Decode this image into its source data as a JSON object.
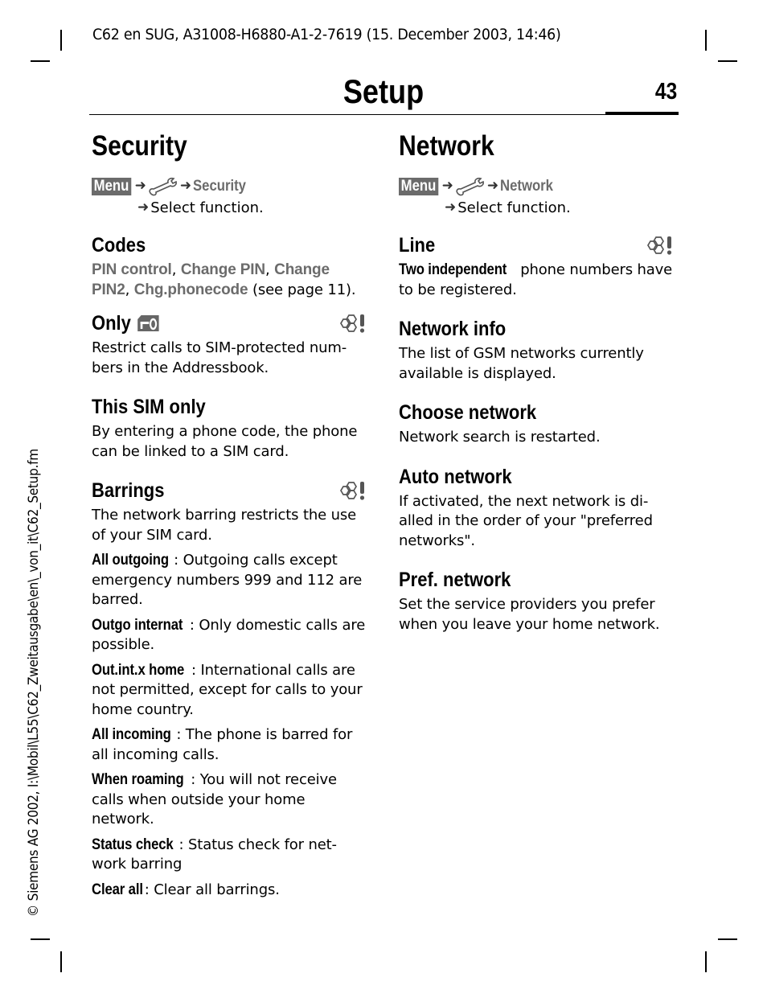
{
  "doc_header": "C62 en SUG, A31008-H6880-A1-2-7619 (15. December 2003, 14:46)",
  "page": {
    "title": "Setup",
    "number": "43"
  },
  "side_note": "© Siemens AG 2002, I:\\Mobil\\L55\\C62_Zweitausgabe\\en\\_von_it\\C62_Setup.fm",
  "icons": {
    "menu_key": "menu-softkey",
    "wrench": "wrench-icon",
    "arrow": "arrow-right-icon",
    "network_dependent": "network-dependent-icon",
    "sim_key": "sim-key-icon"
  },
  "colors": {
    "menu_key_bg": "#6b6b6b",
    "gray_term": "#6b6b6b",
    "text": "#000000"
  },
  "security": {
    "heading": "Security",
    "path": {
      "menu_label": "Menu",
      "arrow": "➜",
      "target": "Security",
      "instruction": "Select function."
    },
    "items": [
      {
        "title": "Codes",
        "gray_terms": [
          "PIN control",
          "Change PIN",
          "Change PIN2",
          "Chg.phonecode"
        ],
        "separator": ", ",
        "suffix": " (see page 11)."
      },
      {
        "title": "Only",
        "network_dependent": true,
        "body": "Restrict calls to SIM-protected num-bers in the Addressbook."
      },
      {
        "title": "This SIM only",
        "body": "By entering a phone code, the phone can be linked to a SIM card."
      },
      {
        "title": "Barrings",
        "network_dependent": true,
        "body": "The network barring restricts the use of your SIM card.",
        "options": [
          {
            "term": "All outgoing",
            "text": ": Outgoing calls except emergency numbers 999 and 112 are barred."
          },
          {
            "term": "Outgo internat",
            "text": ": Only domestic calls are possible."
          },
          {
            "term": "Out.int.x home",
            "text": ": International calls are not permitted, except for calls to your home country."
          },
          {
            "term": "All incoming",
            "text": ": The phone is barred for all incoming calls."
          },
          {
            "term": "When roaming",
            "text": ": You will not receive calls when outside your home network."
          },
          {
            "term": "Status check",
            "text": ": Status check for net-work barring"
          },
          {
            "term": "Clear all",
            "text": ": Clear all barrings."
          }
        ]
      }
    ]
  },
  "network": {
    "heading": "Network",
    "path": {
      "menu_label": "Menu",
      "arrow": "➜",
      "target": "Network",
      "instruction": "Select function."
    },
    "items": [
      {
        "title": "Line",
        "network_dependent": true,
        "lead_term": "Two independent",
        "body": " phone numbers have to be registered."
      },
      {
        "title": "Network info",
        "body": "The list of GSM networks currently available is displayed."
      },
      {
        "title": "Choose network",
        "body": "Network search is restarted."
      },
      {
        "title": "Auto network",
        "body": "If activated, the next network is di-alled in the order of your \"preferred networks\"."
      },
      {
        "title": "Pref. network",
        "body": "Set the service providers you prefer when you leave your home network."
      }
    ]
  }
}
